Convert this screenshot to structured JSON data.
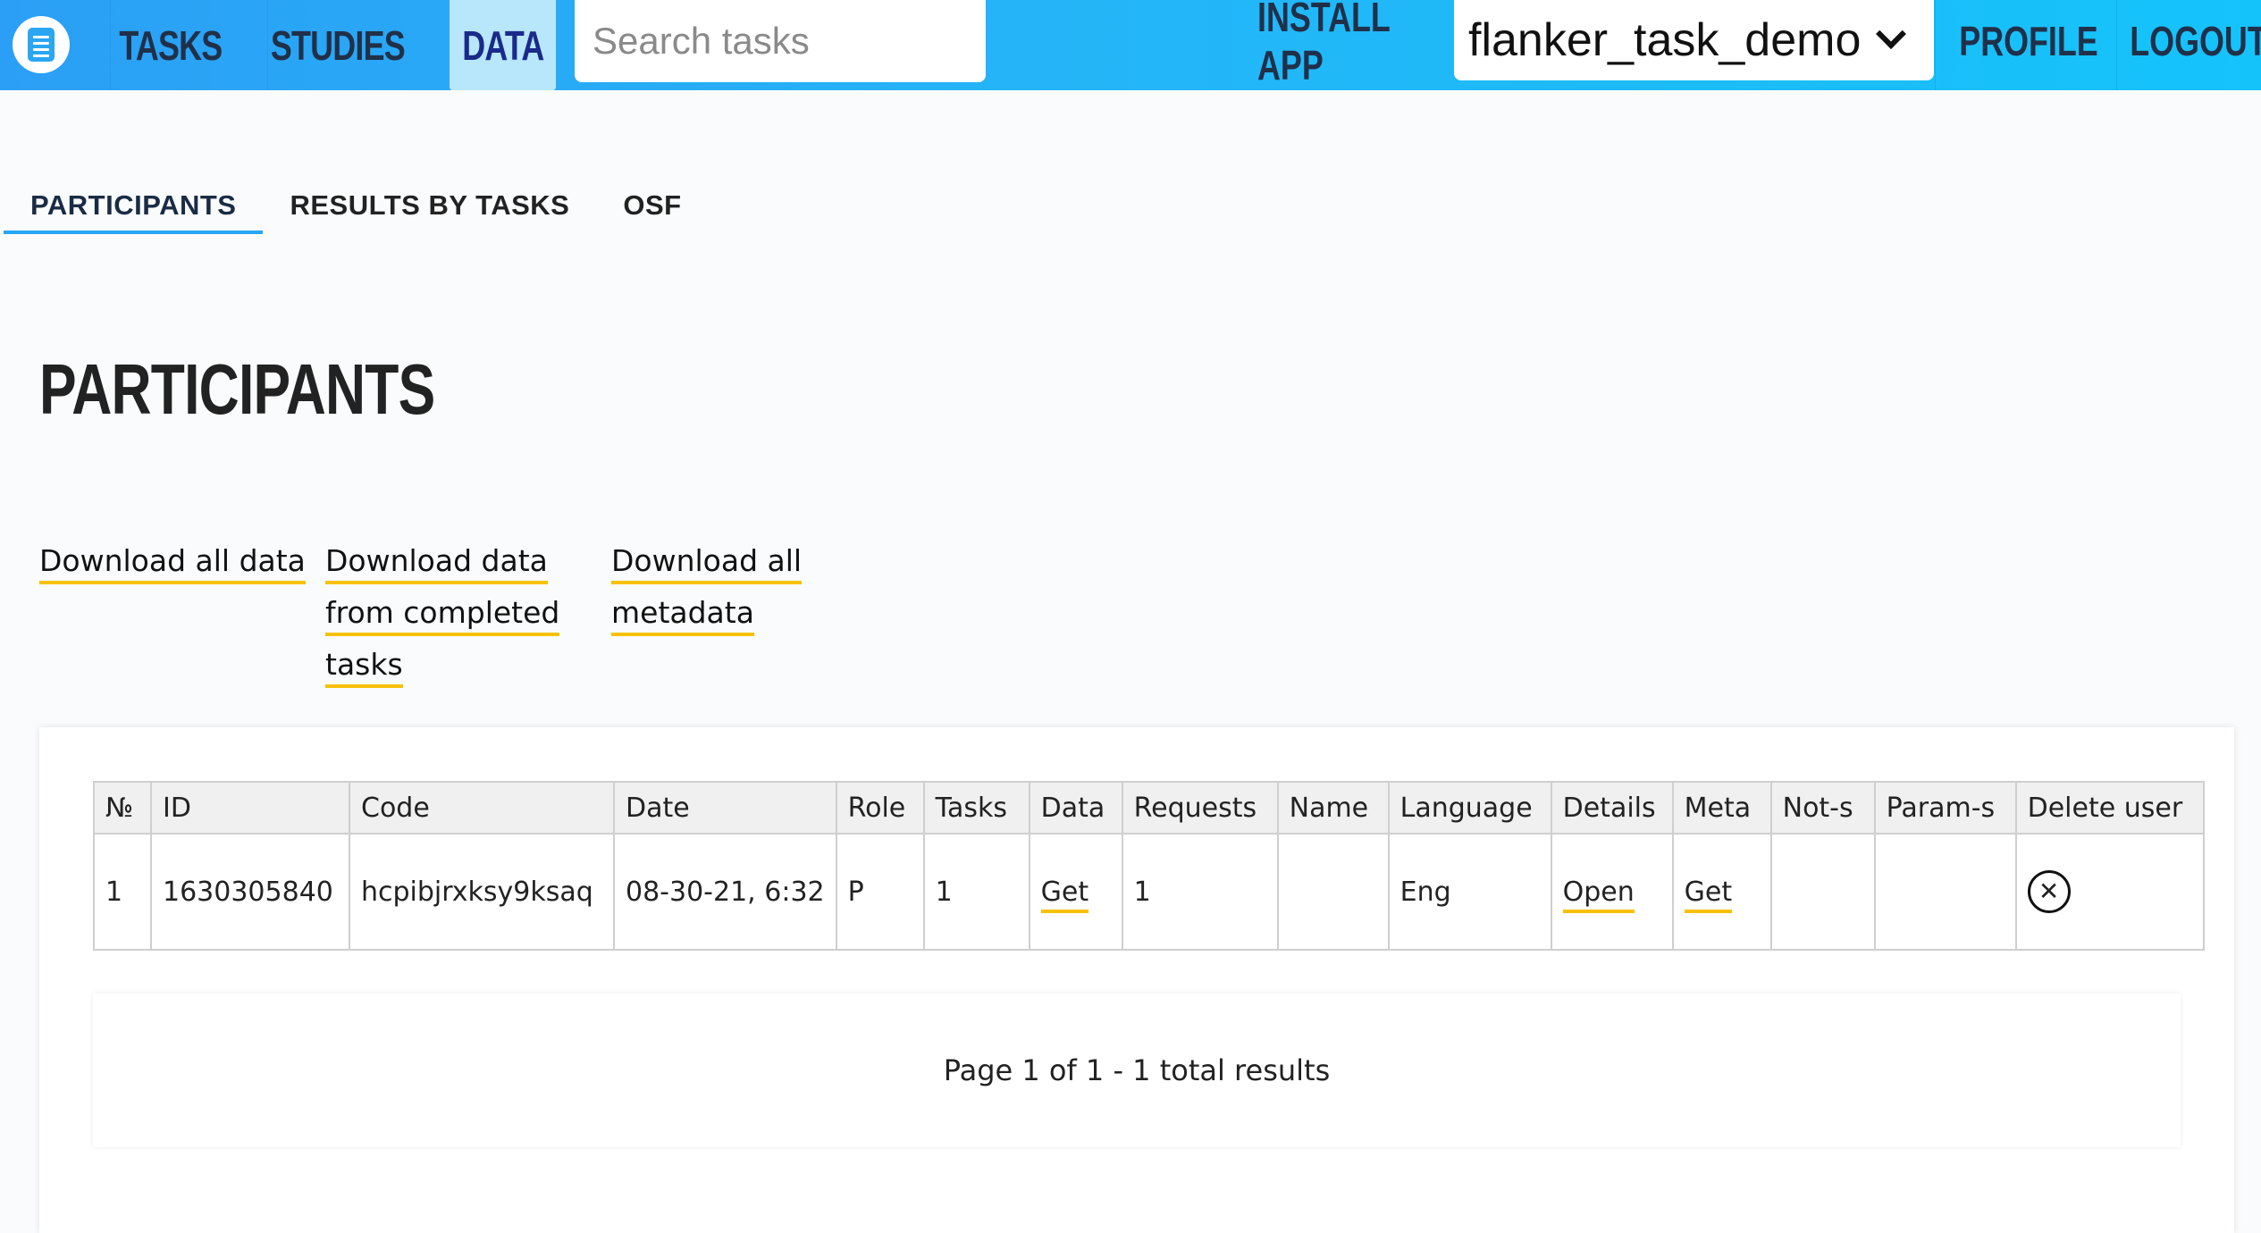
{
  "nav": {
    "tasks": "TASKS",
    "studies": "STUDIES",
    "data": "DATA",
    "search_placeholder": "Search tasks",
    "install_app": "INSTALL APP",
    "study_selected": "flanker_task_demo",
    "profile": "PROFILE",
    "logout": "LOGOUT"
  },
  "subtabs": [
    "PARTICIPANTS",
    "RESULTS BY TASKS",
    "OSF"
  ],
  "page_title": "PARTICIPANTS",
  "downloads": {
    "all_data": "Download all data",
    "completed_line1": "Download data",
    "completed_line2": "from completed",
    "completed_line3": "tasks",
    "metadata_line1": "Download all",
    "metadata_line2": "metadata"
  },
  "table": {
    "headers": [
      "№",
      "ID",
      "Code",
      "Date",
      "Role",
      "Tasks",
      "Data",
      "Requests",
      "Name",
      "Language",
      "Details",
      "Meta",
      "Not-s",
      "Param-s",
      "Delete user"
    ],
    "rows": [
      {
        "num": "1",
        "id": "1630305840",
        "code": "hcpibjrxksy9ksaq",
        "date": "08-30-21, 6:32",
        "role": "P",
        "tasks": "1",
        "data": "Get",
        "requests": "1",
        "name": "",
        "language": "Eng",
        "details": "Open",
        "meta": "Get",
        "nots": "",
        "params": "",
        "delete_icon": "close-circle-icon"
      }
    ]
  },
  "pagination": "Page 1 of 1 - 1 total results",
  "colors": {
    "accent": "#2aa6f3",
    "underline": "#f7c10a",
    "nav_active_bg": "#b8e6fb"
  }
}
